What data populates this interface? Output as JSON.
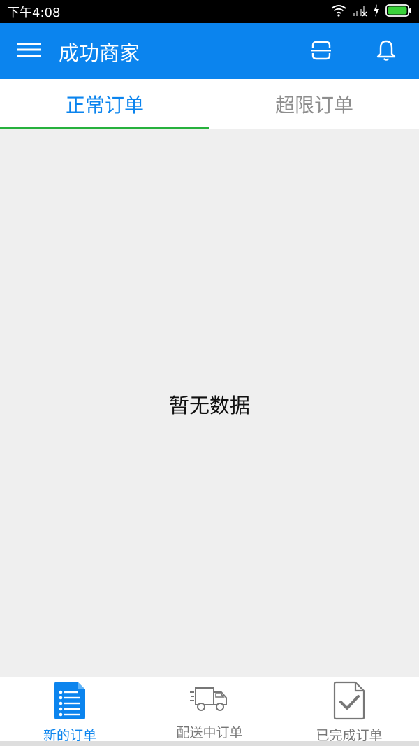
{
  "status_bar": {
    "time": "下午4:08"
  },
  "app_bar": {
    "title": "成功商家",
    "icons": [
      "menu-icon",
      "scan-icon",
      "bell-icon"
    ]
  },
  "tabs": [
    {
      "label": "正常订单",
      "active": true
    },
    {
      "label": "超限订单",
      "active": false
    }
  ],
  "content": {
    "empty_text": "暂无数据"
  },
  "bottom_nav": [
    {
      "label": "新的订单",
      "icon": "order-list-icon",
      "active": true
    },
    {
      "label": "配送中订单",
      "icon": "delivery-truck-icon",
      "active": false
    },
    {
      "label": "已完成订单",
      "icon": "completed-document-icon",
      "active": false
    }
  ],
  "colors": {
    "primary": "#0b84ee",
    "tab_indicator": "#27b13d",
    "inactive_text": "#8d8d8d",
    "background": "#efefef"
  }
}
